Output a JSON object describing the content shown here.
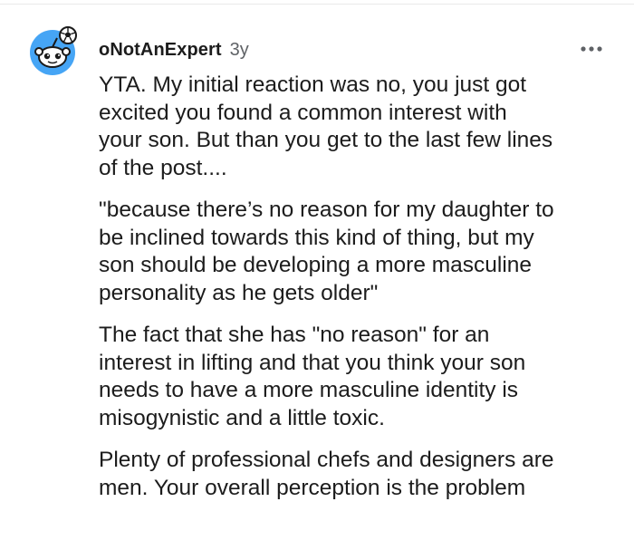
{
  "comment": {
    "username": "oNotAnExpert",
    "timestamp": "3y",
    "avatar_icon": "snoo-avatar-icon",
    "more_icon": "more-options-icon",
    "paragraphs": [
      "YTA. My initial reaction was no, you just got\nexcited you found a common interest with\nyour son. But than you get to the last few lines\nof the post....",
      "\"because there’s no reason for my daughter to\nbe inclined towards this kind of thing, but my\nson should be developing a more masculine\npersonality as he gets older\"",
      "The fact that she has \"no reason\" for an\ninterest in lifting and that you think your son\nneeds to have a more masculine identity is\nmisogynistic and a little toxic.",
      "Plenty of professional chefs and designers are\nmen. Your overall perception is the problem"
    ]
  },
  "colors": {
    "avatar_bg": "#46a5f5",
    "text": "#1c1c1c",
    "muted": "#5f6266",
    "divider": "#e9e9e9"
  }
}
